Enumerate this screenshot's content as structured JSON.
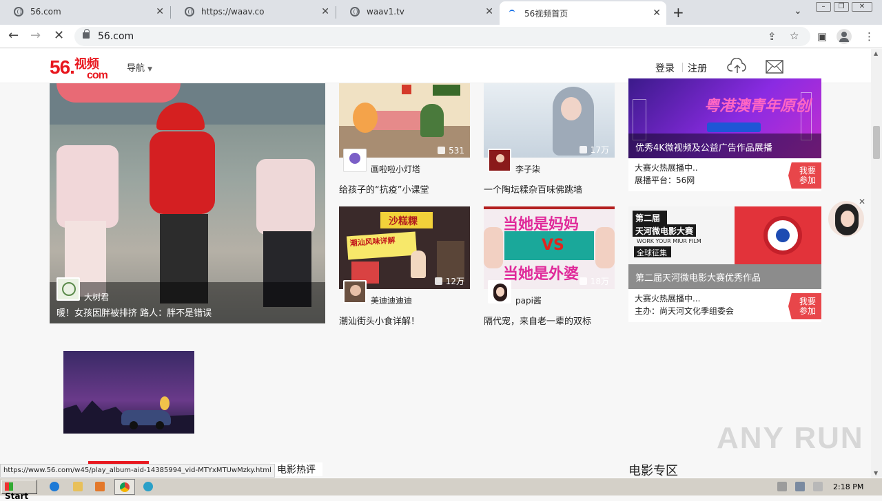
{
  "browser": {
    "tabs": [
      {
        "title": "56.com"
      },
      {
        "title": "https://waav.co"
      },
      {
        "title": "waav1.tv"
      },
      {
        "title": "56视频首页"
      }
    ],
    "url": "56.com",
    "status_url": "https://www.56.com/w45/play_album-aid-14385994_vid-MTYxMTUwMzky.html"
  },
  "site": {
    "logo_main": "56.",
    "logo_sub": "视频",
    "logo_com": "com",
    "nav_label": "导航",
    "login": "登录",
    "register": "注册"
  },
  "featured": {
    "author": "大树君",
    "title": "暖！女孩因胖被排挤 路人：胖不是错误"
  },
  "videos": [
    {
      "count": "531",
      "author": "画啦啦小灯塔",
      "title": "给孩子的“抗疫”小课堂"
    },
    {
      "count": "17万",
      "author": "李子柒",
      "title": "一个陶坛糅杂百味佛跳墙"
    },
    {
      "count": "12万",
      "author": "美迪迪迪迪",
      "title": "潮汕街头小食详解！"
    },
    {
      "count": "18万",
      "author": "papi酱",
      "title": "隔代宠，来自老一辈的双标"
    }
  ],
  "ads": [
    {
      "overlay": "优秀4K微视频及公益广告作品展播",
      "line1": "大赛火热展播中..",
      "line2": "展播平台：56网",
      "join": "我要参加",
      "banner_text": "粤港澳青年原创"
    },
    {
      "overlay": "第二届天河微电影大赛优秀作品",
      "line1": "大赛火热展播中...",
      "line2": "主办：尚天河文化季组委会",
      "join": "我要参加",
      "banner_line1": "第二届",
      "banner_line2": "天河微电影大赛",
      "banner_line3": "WORK YOUR MIUR FILM",
      "banner_line4": "全球征集"
    }
  ],
  "section_labels": {
    "film_review": "电影热评",
    "film_zone": "电影专区"
  },
  "thumb_texts": {
    "food_sign": "沙糕粿",
    "food_banner": "潮汕风味详解",
    "mama1": "当她是妈妈",
    "vs": "VS",
    "mama2": "当她是外婆"
  },
  "taskbar": {
    "start": "Start",
    "time": "2:18 PM"
  },
  "watermark": "ANY RUN",
  "colors": {
    "brand": "#e8171e",
    "join": "#e8464a",
    "ad_purple": "#7a2bd6"
  }
}
